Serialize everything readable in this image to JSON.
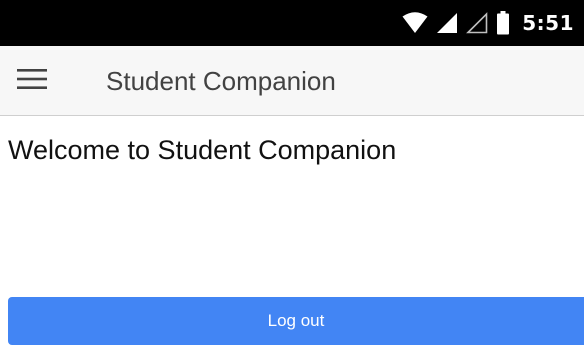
{
  "status_bar": {
    "time": "5:51",
    "icons": [
      "wifi-icon",
      "cell-signal-icon",
      "cell-signal-empty-icon",
      "battery-icon"
    ]
  },
  "app_bar": {
    "title": "Student Companion",
    "menu_icon": "hamburger-menu-icon"
  },
  "main": {
    "welcome_text": "Welcome to Student Companion",
    "logout_label": "Log out"
  },
  "colors": {
    "status_bar_bg": "#000000",
    "app_bar_bg": "#f7f7f7",
    "primary_button": "#4285f4",
    "title_text": "#424242"
  }
}
